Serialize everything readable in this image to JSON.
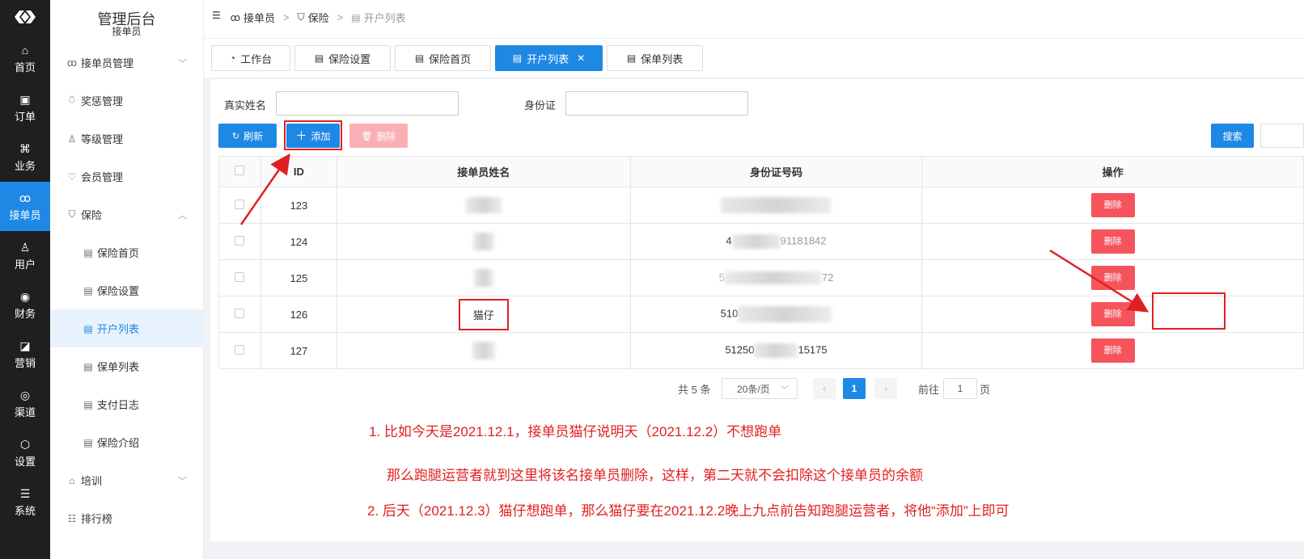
{
  "rail": {
    "items": [
      {
        "label": "首页",
        "icon": "home-icon"
      },
      {
        "label": "订单",
        "icon": "order-icon"
      },
      {
        "label": "业务",
        "icon": "command-icon"
      },
      {
        "label": "接单员",
        "icon": "bike-icon"
      },
      {
        "label": "用户",
        "icon": "user-icon"
      },
      {
        "label": "财务",
        "icon": "finance-icon"
      },
      {
        "label": "营销",
        "icon": "chart-icon"
      },
      {
        "label": "渠道",
        "icon": "compass-icon"
      },
      {
        "label": "设置",
        "icon": "settings-icon"
      },
      {
        "label": "系统",
        "icon": "sliders-icon"
      }
    ]
  },
  "sidebar": {
    "title": "管理后台",
    "subtitle": "接单员",
    "items": [
      {
        "label": "接单员管理",
        "icon": "bike-icon"
      },
      {
        "label": "奖惩管理",
        "icon": "medal-icon"
      },
      {
        "label": "等级管理",
        "icon": "user-level-icon"
      },
      {
        "label": "会员管理",
        "icon": "vip-icon"
      },
      {
        "label": "保险",
        "icon": "shield-icon"
      },
      {
        "label": "保险首页",
        "icon": "doc-icon"
      },
      {
        "label": "保险设置",
        "icon": "doc-icon"
      },
      {
        "label": "开户列表",
        "icon": "doc-icon"
      },
      {
        "label": "保单列表",
        "icon": "doc-icon"
      },
      {
        "label": "支付日志",
        "icon": "doc-icon"
      },
      {
        "label": "保险介绍",
        "icon": "doc-icon"
      },
      {
        "label": "培训",
        "icon": "training-icon"
      },
      {
        "label": "排行榜",
        "icon": "list-icon"
      }
    ]
  },
  "breadcrumb": {
    "first": "接单员",
    "second": "保险",
    "third": "开户列表"
  },
  "tabs": [
    {
      "label": "工作台"
    },
    {
      "label": "保险设置"
    },
    {
      "label": "保险首页"
    },
    {
      "label": "开户列表"
    },
    {
      "label": "保单列表"
    }
  ],
  "filters": {
    "name_label": "真实姓名",
    "id_label": "身份证"
  },
  "buttons": {
    "refresh": "刷新",
    "add": "添加",
    "delete": "删除",
    "search": "搜索"
  },
  "table": {
    "headers": [
      "ID",
      "接单员姓名",
      "身份证号码",
      "操作"
    ],
    "rows": [
      {
        "id": "123",
        "name": "",
        "idcard": "",
        "action": "删除"
      },
      {
        "id": "124",
        "name": "",
        "idcard": "4",
        "idcard_tail": "91181842",
        "action": "删除"
      },
      {
        "id": "125",
        "name": "",
        "idcard": "5",
        "idcard_tail": "72",
        "action": "删除"
      },
      {
        "id": "126",
        "name": "猫仔",
        "idcard": "510",
        "action": "删除"
      },
      {
        "id": "127",
        "name": "",
        "idcard": "51250",
        "idcard_tail": "15175",
        "action": "删除"
      }
    ]
  },
  "pagination": {
    "total": "共 5 条",
    "page_size": "20条/页",
    "current": "1",
    "goto_label": "前往",
    "goto_value": "1",
    "page_suffix": "页"
  },
  "notes": {
    "line1": "1. 比如今天是2021.12.1，接单员猫仔说明天（2021.12.2）不想跑单",
    "line2": "那么跑腿运营者就到这里将该名接单员删除，这样，第二天就不会扣除这个接单员的余额",
    "line3": "2.  后天（2021.12.3）猫仔想跑单，那么猫仔要在2021.12.2晚上九点前告知跑腿运营者，将他“添加”上即可"
  },
  "colors": {
    "primary": "#1e88e5",
    "danger": "#f5545d",
    "annotation": "#e02020"
  }
}
